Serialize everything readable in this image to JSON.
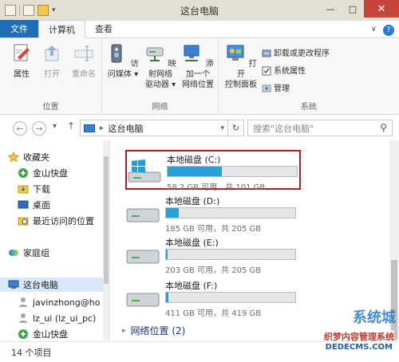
{
  "window": {
    "title": "这台电脑"
  },
  "ribbon_tabs": {
    "file": "文件",
    "computer": "计算机",
    "view": "查看"
  },
  "ribbon": {
    "location": {
      "label": "位置",
      "properties": "属性",
      "open": "打开",
      "rename": "重命名"
    },
    "network": {
      "label": "网络",
      "media_line1": "访问媒体",
      "map_line1": "映射网络",
      "map_line2": "驱动器",
      "addloc_line1": "添加一个",
      "addloc_line2": "网络位置"
    },
    "system": {
      "label": "系统",
      "cp_line1": "打开",
      "cp_line2": "控制面板",
      "uninstall": "卸载或更改程序",
      "sysprops": "系统属性",
      "manage": "管理"
    }
  },
  "address": {
    "location": "这台电脑",
    "search_placeholder": "搜索\"这台电脑\""
  },
  "nav": {
    "favorites": "收藏夹",
    "jinshan1": "金山快盘",
    "downloads": "下载",
    "desktop": "桌面",
    "recent": "最近访问的位置",
    "homegroup": "家庭组",
    "thispc": "这台电脑",
    "javin": "javinzhong@ho",
    "lzui": "lz_ui (lz_ui_pc)",
    "jinshan2": "金山快盘"
  },
  "drives": [
    {
      "name": "本地磁盘 (C:)",
      "info": "58.2 GB 可用，共 101 GB",
      "used_fraction": 0.42
    },
    {
      "name": "本地磁盘 (D:)",
      "info": "185 GB 可用，共 205 GB",
      "used_fraction": 0.1
    },
    {
      "name": "本地磁盘 (E:)",
      "info": "203 GB 可用，共 205 GB",
      "used_fraction": 0.01
    },
    {
      "name": "本地磁盘 (F:)",
      "info": "411 GB 可用，共 419 GB",
      "used_fraction": 0.02
    }
  ],
  "network_group": "网络位置 (2)",
  "status": {
    "count": "14 个项目"
  },
  "watermark": {
    "logo": "系统城",
    "line1": "织梦内容管理系统",
    "line2": "DEDECMS.COM"
  }
}
